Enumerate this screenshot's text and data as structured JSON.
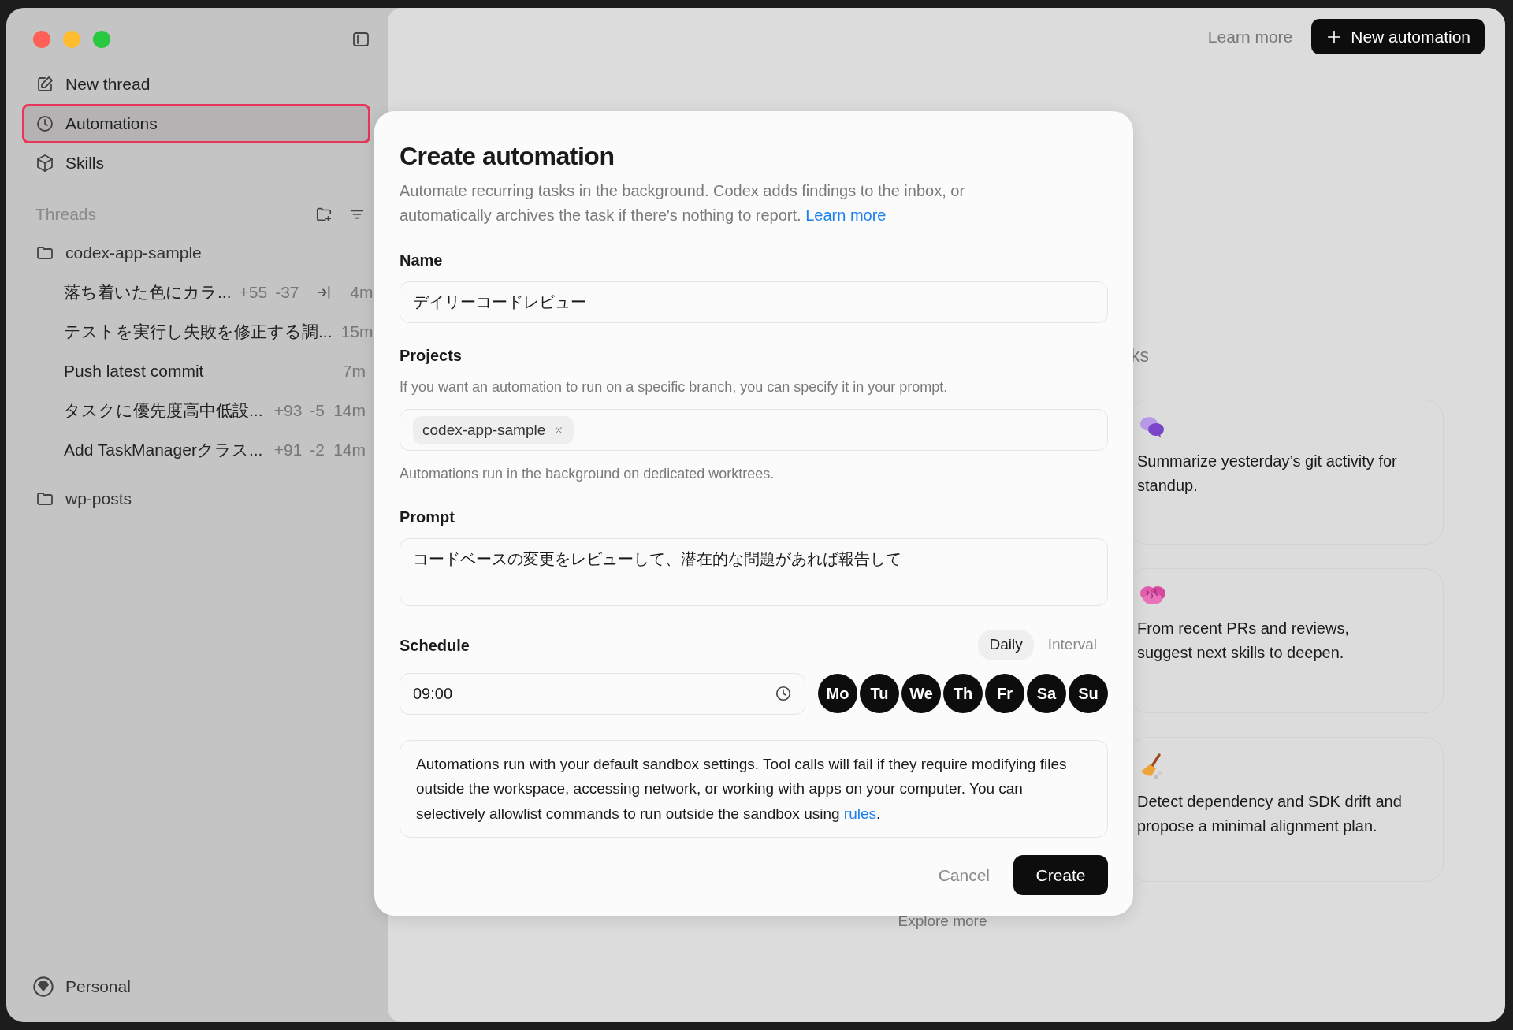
{
  "sidebar": {
    "nav": [
      {
        "label": "New thread",
        "selected": false,
        "highlighted": false
      },
      {
        "label": "Automations",
        "selected": true,
        "highlighted": true
      },
      {
        "label": "Skills",
        "selected": false,
        "highlighted": false
      }
    ],
    "threads": {
      "title": "Threads",
      "projects": [
        {
          "name": "codex-app-sample",
          "children": [
            {
              "title": "落ち着いた色にカラ...",
              "added": "+55",
              "removed": "-37",
              "handoff": true,
              "time": "4m"
            },
            {
              "title": "テストを実行し失敗を修正する調...",
              "handoff": false,
              "time": "15m"
            },
            {
              "title": "Push latest commit",
              "handoff": false,
              "time": "7m"
            },
            {
              "title": "タスクに優先度高中低設...",
              "added": "+93",
              "removed": "-5",
              "handoff": false,
              "time": "14m"
            },
            {
              "title": "Add TaskManagerクラス...",
              "added": "+91",
              "removed": "-2",
              "handoff": false,
              "time": "14m"
            }
          ]
        },
        {
          "name": "wp-posts"
        }
      ]
    },
    "footer": {
      "label": "Personal"
    }
  },
  "main": {
    "learn_more": "Learn more",
    "new_button": "New automation",
    "heading": "ks",
    "cards": [
      {
        "text": "Summarize yesterday’s git activity for standup."
      },
      {
        "text": "From recent PRs and reviews, suggest next skills to deepen."
      },
      {
        "text": "Detect dependency and SDK drift and propose a minimal alignment plan."
      }
    ],
    "explore": "Explore more"
  },
  "dialog": {
    "title": "Create automation",
    "description": "Automate recurring tasks in the background. Codex adds findings to the inbox, or automatically archives the task if there's nothing to report.",
    "description_link": "Learn more",
    "name": {
      "label": "Name",
      "value": "デイリーコードレビュー"
    },
    "projects": {
      "label": "Projects",
      "hint": "If you want an automation to run on a specific branch, you can specify it in your prompt.",
      "tags": [
        {
          "label": "codex-app-sample"
        }
      ],
      "note": "Automations run in the background on dedicated worktrees."
    },
    "prompt": {
      "label": "Prompt",
      "value": "コードベースの変更をレビューして、潜在的な問題があれば報告して"
    },
    "schedule": {
      "label": "Schedule",
      "modes": [
        {
          "label": "Daily",
          "selected": true
        },
        {
          "label": "Interval",
          "selected": false
        }
      ],
      "time": "09:00",
      "days": [
        {
          "label": "Mo",
          "selected": true
        },
        {
          "label": "Tu",
          "selected": true
        },
        {
          "label": "We",
          "selected": true
        },
        {
          "label": "Th",
          "selected": true
        },
        {
          "label": "Fr",
          "selected": true
        },
        {
          "label": "Sa",
          "selected": true
        },
        {
          "label": "Su",
          "selected": true
        }
      ]
    },
    "notice": {
      "text": "Automations run with your default sandbox settings. Tool calls will fail if they require modifying files outside the workspace, accessing network, or working with apps on your computer. You can selectively allowlist commands to run outside the sandbox using",
      "link": "rules",
      "after": "."
    },
    "cancel": "Cancel",
    "create": "Create"
  }
}
